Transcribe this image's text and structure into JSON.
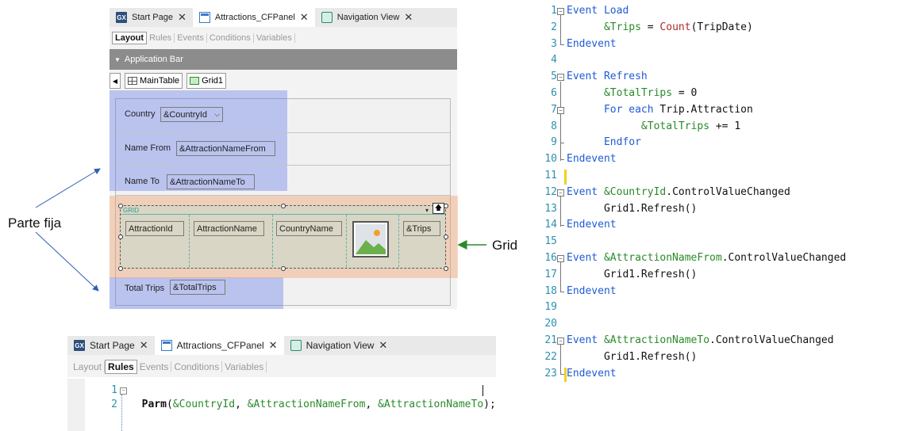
{
  "top_editor": {
    "tabs": [
      {
        "icon": "gx-icon",
        "label": "Start Page"
      },
      {
        "icon": "panel-icon",
        "label": "Attractions_CFPanel"
      },
      {
        "icon": "navigation-icon",
        "label": "Navigation View"
      }
    ],
    "close_symbol": "✕",
    "subtabs": [
      "Layout",
      "Rules",
      "Events",
      "Conditions",
      "Variables"
    ],
    "app_bar_label": "Application Bar",
    "breadcrumb": [
      "MainTable",
      "Grid1"
    ],
    "fields": {
      "country_label": "Country",
      "country_value": "&CountryId",
      "name_from_label": "Name From",
      "name_from_value": "&AttractionNameFrom",
      "name_to_label": "Name To",
      "name_to_value": "&AttractionNameTo",
      "grid_tag": "GRID",
      "grid_columns": [
        "AttractionId",
        "AttractionName",
        "CountryName",
        "",
        "&Trips"
      ],
      "total_label": "Total Trips",
      "total_value": "&TotalTrips"
    }
  },
  "annotations": {
    "parte_fija": "Parte fija",
    "grid": "Grid"
  },
  "bottom_editor": {
    "tabs": [
      {
        "icon": "gx-icon",
        "label": "Start Page"
      },
      {
        "icon": "panel-icon",
        "label": "Attractions_CFPanel"
      },
      {
        "icon": "navigation-icon",
        "label": "Navigation View"
      }
    ],
    "subtabs": [
      "Layout",
      "Rules",
      "Events",
      "Conditions",
      "Variables"
    ],
    "line_numbers": [
      "1",
      "2"
    ],
    "rule_parts": [
      "Parm",
      "(",
      "&CountryId",
      ", ",
      "&AttractionNameFrom",
      ", ",
      "&AttractionNameTo",
      ");"
    ]
  },
  "code_editor": {
    "line_numbers": [
      "1",
      "2",
      "3",
      "4",
      "5",
      "6",
      "7",
      "8",
      "9",
      "10",
      "11",
      "12",
      "13",
      "14",
      "15",
      "16",
      "17",
      "18",
      "19",
      "20",
      "21",
      "22",
      "23"
    ],
    "lines": [
      [
        [
          "kw",
          "Event Load"
        ]
      ],
      [
        [
          "pl",
          "      "
        ],
        [
          "vr",
          "&Trips"
        ],
        [
          "pl",
          " = "
        ],
        [
          "fn",
          "Count"
        ],
        [
          "pl",
          "(TripDate)"
        ]
      ],
      [
        [
          "kw",
          "Endevent"
        ]
      ],
      [],
      [
        [
          "kw",
          "Event Refresh"
        ]
      ],
      [
        [
          "pl",
          "      "
        ],
        [
          "vr",
          "&TotalTrips"
        ],
        [
          "pl",
          " = 0"
        ]
      ],
      [
        [
          "pl",
          "      "
        ],
        [
          "kw",
          "For each"
        ],
        [
          "pl",
          " Trip.Attraction"
        ]
      ],
      [
        [
          "pl",
          "            "
        ],
        [
          "vr",
          "&TotalTrips"
        ],
        [
          "pl",
          " += 1"
        ]
      ],
      [
        [
          "pl",
          "      "
        ],
        [
          "kw",
          "Endfor"
        ]
      ],
      [
        [
          "kw",
          "Endevent"
        ]
      ],
      [],
      [
        [
          "kw",
          "Event "
        ],
        [
          "vr",
          "&CountryId"
        ],
        [
          "pl",
          ".ControlValueChanged"
        ]
      ],
      [
        [
          "pl",
          "      Grid1.Refresh()"
        ]
      ],
      [
        [
          "kw",
          "Endevent"
        ]
      ],
      [],
      [
        [
          "kw",
          "Event "
        ],
        [
          "vr",
          "&AttractionNameFrom"
        ],
        [
          "pl",
          ".ControlValueChanged"
        ]
      ],
      [
        [
          "pl",
          "      Grid1.Refresh()"
        ]
      ],
      [
        [
          "kw",
          "Endevent"
        ]
      ],
      [],
      [],
      [
        [
          "kw",
          "Event "
        ],
        [
          "vr",
          "&AttractionNameTo"
        ],
        [
          "pl",
          ".ControlValueChanged"
        ]
      ],
      [
        [
          "pl",
          "      Grid1.Refresh()"
        ]
      ],
      [
        [
          "kw",
          "Endevent"
        ]
      ]
    ]
  }
}
